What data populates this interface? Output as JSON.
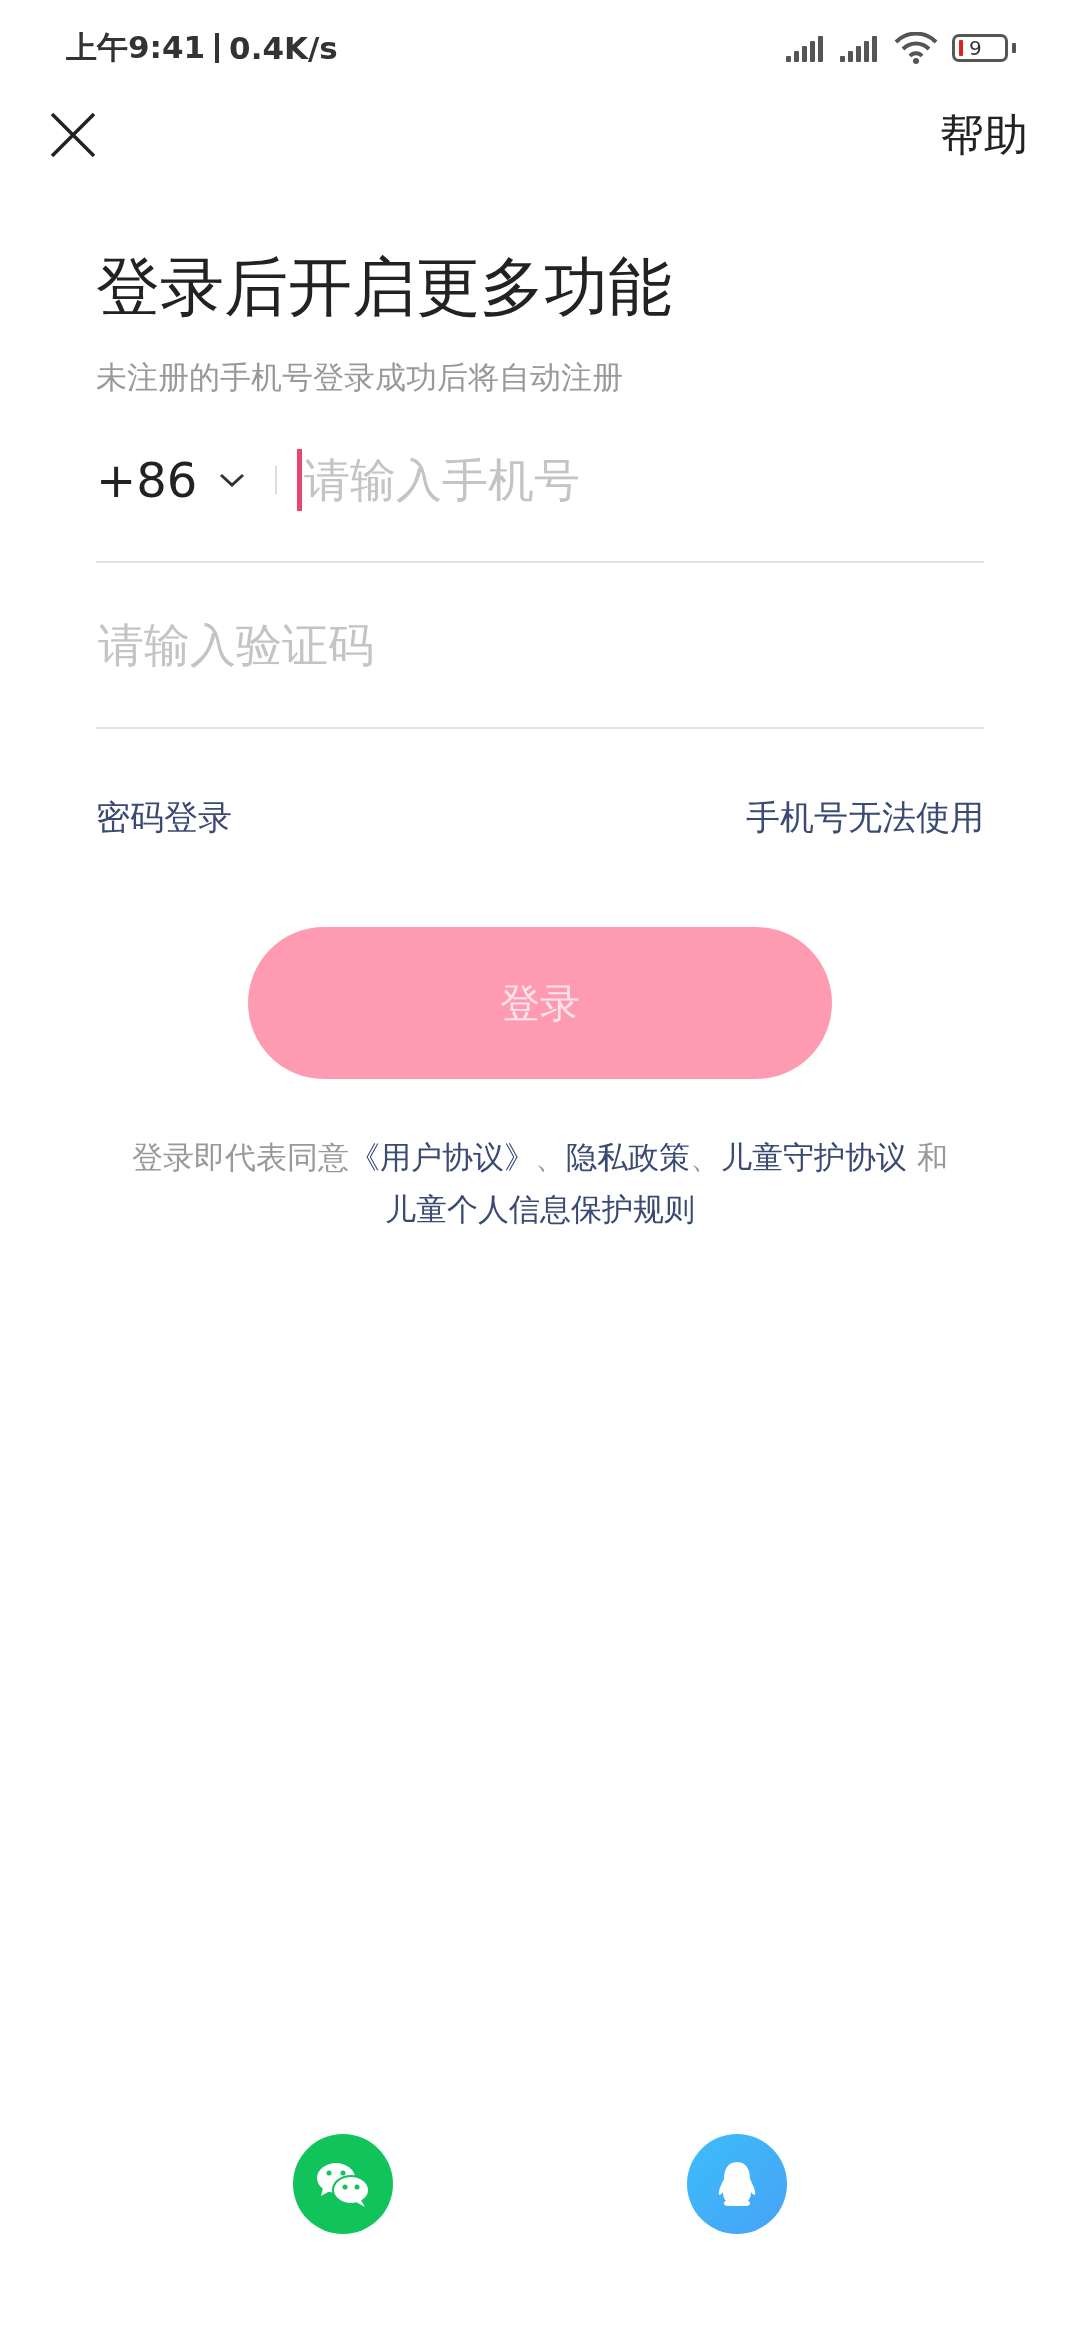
{
  "status_bar": {
    "time": "上午9:41",
    "speed": "0.4K/s",
    "battery": "9"
  },
  "top_bar": {
    "help": "帮助"
  },
  "title": "登录后开启更多功能",
  "subtitle": "未注册的手机号登录成功后将自动注册",
  "phone": {
    "country_code": "+86",
    "placeholder": "请输入手机号",
    "focused": true
  },
  "code": {
    "placeholder": "请输入验证码"
  },
  "links": [
    "密码登录",
    "手机号无法使用"
  ],
  "login_button": {
    "label": "登录",
    "disabled": true
  },
  "agreement": [
    {
      "kind": "text",
      "text": "登录即代表同意"
    },
    {
      "kind": "link",
      "text": "《用户协议》"
    },
    {
      "kind": "text",
      "text": "、"
    },
    {
      "kind": "link",
      "text": "隐私政策"
    },
    {
      "kind": "text",
      "text": "、"
    },
    {
      "kind": "link",
      "text": "儿童守护协议"
    },
    {
      "kind": "text",
      "text": " 和 "
    },
    {
      "kind": "link",
      "text": "儿童个人信息保护规则"
    }
  ],
  "social": [
    {
      "kind": "wechat"
    },
    {
      "kind": "qq"
    }
  ]
}
